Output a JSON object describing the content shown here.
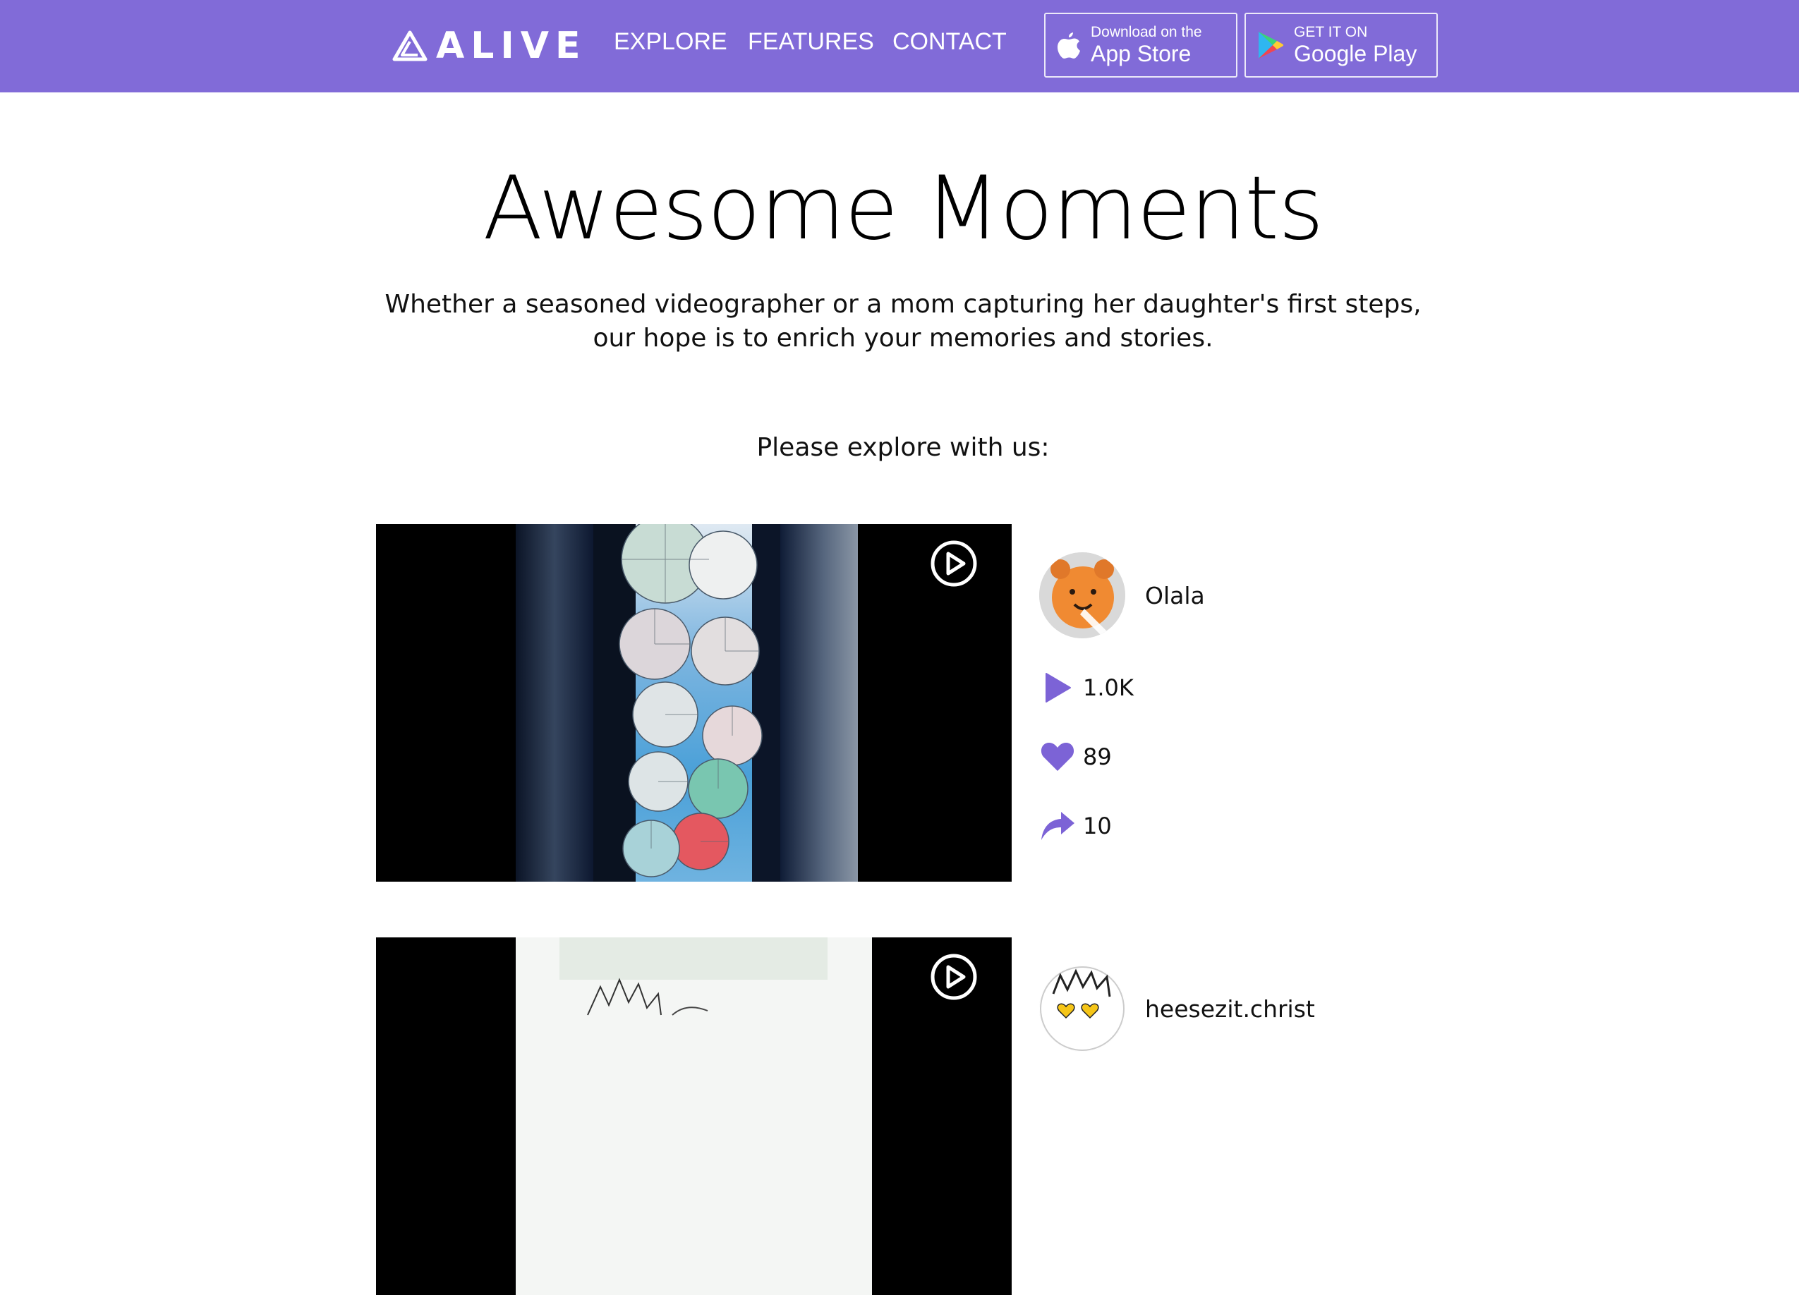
{
  "nav": {
    "brand": "ALIVE",
    "links": [
      "EXPLORE",
      "FEATURES",
      "CONTACT"
    ],
    "app_store": {
      "small": "Download on the",
      "big": "App Store"
    },
    "google_play": {
      "small": "GET IT ON",
      "big": "Google Play"
    },
    "bg_color": "#816bd8"
  },
  "hero": {
    "title": "Awesome Moments",
    "subtitle_line1": "Whether a seasoned videographer or a mom capturing her daughter's first steps,",
    "subtitle_line2": "our hope is to enrich your memories and stories.",
    "explore_prompt": "Please explore with us:"
  },
  "posts": [
    {
      "username": "Olala",
      "plays": "1.0K",
      "likes": "89",
      "shares": "10"
    },
    {
      "username": "heesezit.christ"
    }
  ],
  "colors": {
    "accent": "#7c63d6"
  },
  "icons": [
    "logo-icon",
    "apple-icon",
    "google-play-icon",
    "play-circle-icon",
    "play-icon",
    "heart-icon",
    "share-icon"
  ]
}
